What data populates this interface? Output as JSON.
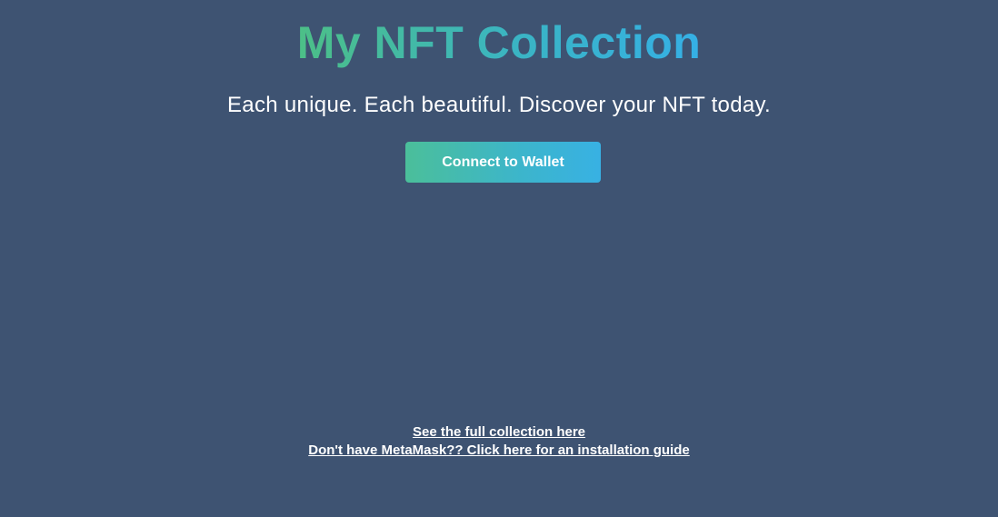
{
  "hero": {
    "title": "My NFT Collection",
    "tagline": "Each unique. Each beautiful. Discover your NFT today."
  },
  "actions": {
    "connect_label": "Connect to Wallet"
  },
  "footer": {
    "collection_link": "See the full collection here",
    "metamask_link": "Don't have MetaMask?? Click here for an installation guide"
  },
  "colors": {
    "background": "#3e5372",
    "gradient_start": "#4cbf87",
    "gradient_end": "#35b0e6",
    "text": "#ffffff"
  }
}
